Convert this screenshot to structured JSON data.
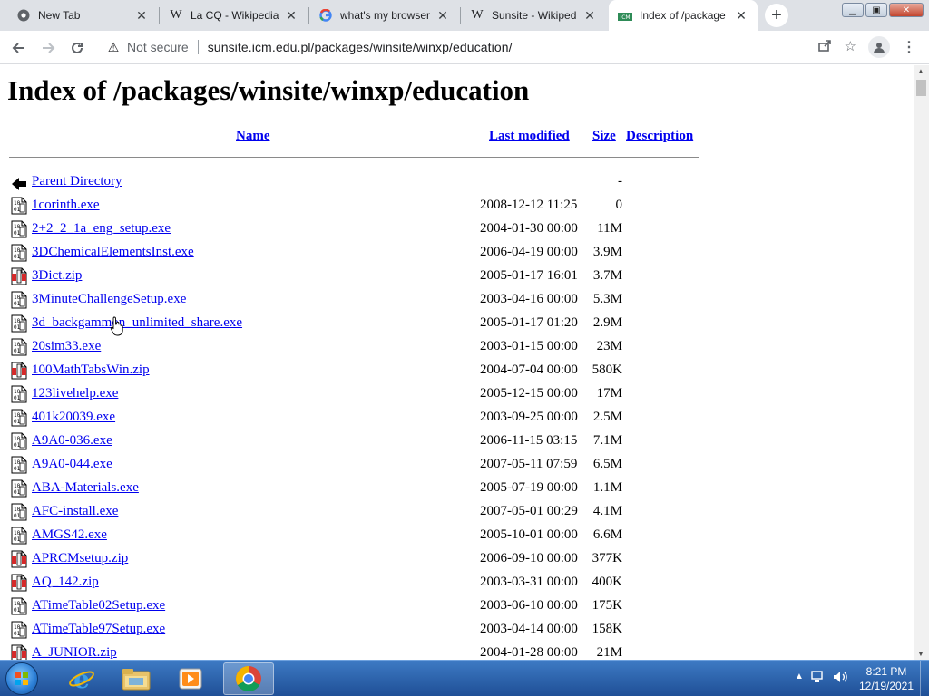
{
  "browser": {
    "tabs": [
      {
        "title": "New Tab",
        "icon": "chrome-icon",
        "active": false
      },
      {
        "title": "La CQ - Wikipedia",
        "icon": "wikipedia-icon",
        "active": false
      },
      {
        "title": "what's my browser",
        "icon": "google-icon",
        "active": false
      },
      {
        "title": "Sunsite - Wikipedia",
        "icon": "wikipedia-icon",
        "active": false
      },
      {
        "title": "Index of /package",
        "icon": "sunsite-icon",
        "active": true
      }
    ],
    "new_tab": "+",
    "security_label": "Not secure",
    "url": "sunsite.icm.edu.pl/packages/winsite/winxp/education/"
  },
  "page": {
    "title": "Index of /packages/winsite/winxp/education",
    "headers": {
      "name": "Name",
      "modified": "Last modified",
      "size": "Size",
      "description": "Description"
    },
    "files": [
      {
        "name": "Parent Directory",
        "date": "",
        "size": "-",
        "type": "parent"
      },
      {
        "name": "1corinth.exe",
        "date": "2008-12-12 11:25",
        "size": "0",
        "type": "exe"
      },
      {
        "name": "2+2_2_1a_eng_setup.exe",
        "date": "2004-01-30 00:00",
        "size": "11M",
        "type": "exe"
      },
      {
        "name": "3DChemicalElementsInst.exe",
        "date": "2006-04-19 00:00",
        "size": "3.9M",
        "type": "exe"
      },
      {
        "name": "3Dict.zip",
        "date": "2005-01-17 16:01",
        "size": "3.7M",
        "type": "zip"
      },
      {
        "name": "3MinuteChallengeSetup.exe",
        "date": "2003-04-16 00:00",
        "size": "5.3M",
        "type": "exe"
      },
      {
        "name": "3d_backgammon_unlimited_share.exe",
        "date": "2005-01-17 01:20",
        "size": "2.9M",
        "type": "exe"
      },
      {
        "name": "20sim33.exe",
        "date": "2003-01-15 00:00",
        "size": "23M",
        "type": "exe"
      },
      {
        "name": "100MathTabsWin.zip",
        "date": "2004-07-04 00:00",
        "size": "580K",
        "type": "zip"
      },
      {
        "name": "123livehelp.exe",
        "date": "2005-12-15 00:00",
        "size": "17M",
        "type": "exe"
      },
      {
        "name": "401k20039.exe",
        "date": "2003-09-25 00:00",
        "size": "2.5M",
        "type": "exe"
      },
      {
        "name": "A9A0-036.exe",
        "date": "2006-11-15 03:15",
        "size": "7.1M",
        "type": "exe"
      },
      {
        "name": "A9A0-044.exe",
        "date": "2007-05-11 07:59",
        "size": "6.5M",
        "type": "exe"
      },
      {
        "name": "ABA-Materials.exe",
        "date": "2005-07-19 00:00",
        "size": "1.1M",
        "type": "exe"
      },
      {
        "name": "AFC-install.exe",
        "date": "2007-05-01 00:29",
        "size": "4.1M",
        "type": "exe"
      },
      {
        "name": "AMGS42.exe",
        "date": "2005-10-01 00:00",
        "size": "6.6M",
        "type": "exe"
      },
      {
        "name": "APRCMsetup.zip",
        "date": "2006-09-10 00:00",
        "size": "377K",
        "type": "zip"
      },
      {
        "name": "AQ_142.zip",
        "date": "2003-03-31 00:00",
        "size": "400K",
        "type": "zip"
      },
      {
        "name": "ATimeTable02Setup.exe",
        "date": "2003-06-10 00:00",
        "size": "175K",
        "type": "exe"
      },
      {
        "name": "ATimeTable97Setup.exe",
        "date": "2003-04-14 00:00",
        "size": "158K",
        "type": "exe"
      },
      {
        "name": "A_JUNIOR.zip",
        "date": "2004-01-28 00:00",
        "size": "21M",
        "type": "zip"
      }
    ]
  },
  "taskbar": {
    "apps": [
      "internet-explorer-icon",
      "file-explorer-icon",
      "media-player-icon",
      "chrome-icon"
    ],
    "time": "8:21 PM",
    "date": "12/19/2021"
  }
}
